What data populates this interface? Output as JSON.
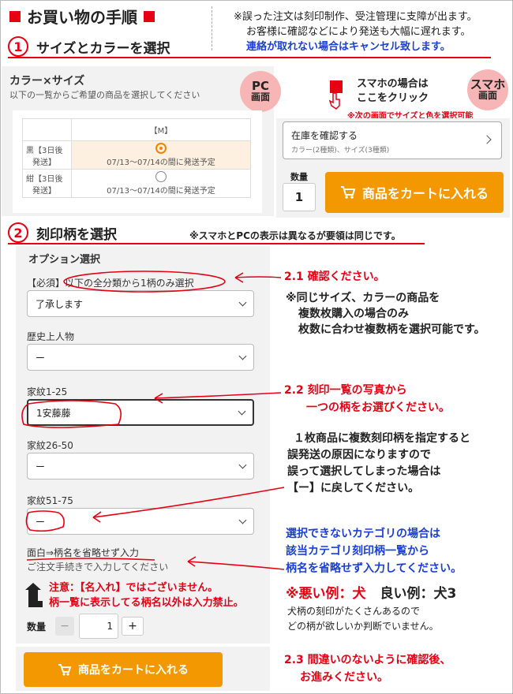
{
  "header": {
    "title": "お買い物の手順",
    "warning_line1": "※誤った注文は刻印制作、受注管理に支障が出ます。",
    "warning_line2": "お客様に確認などにより発送も大幅に遅れます。",
    "warning_line3": "連絡が取れない場合はキャンセル致します。"
  },
  "step1": {
    "number": "1",
    "label": "サイズとカラーを選択"
  },
  "pc_panel": {
    "heading": "カラー×サイズ",
    "sub": "以下の一覧からご希望の商品を選択してください",
    "bubble_top": "PC",
    "bubble_bottom": "画面",
    "table": {
      "col_header": "【M】",
      "rows": [
        {
          "label_line1": "黒【3日後",
          "label_line2": "発送】",
          "note": "07/13〜07/14の間に発送予定",
          "selected": true
        },
        {
          "label_line1": "紺【3日後",
          "label_line2": "発送】",
          "note": "07/13〜07/14の間に発送予定",
          "selected": false
        }
      ]
    }
  },
  "sp_panel": {
    "hint_line1": "スマホの場合は",
    "hint_line2": "ここをクリック",
    "bubble_top": "スマホ",
    "bubble_bottom": "画面",
    "note": "※次の画面でサイズと色を選択可能",
    "stock_title": "在庫を確認する",
    "stock_sub": "カラー(2種類)、サイズ(3種類)",
    "qty_label": "数量",
    "qty_value": "1",
    "cart_label": "商品をカートに入れる"
  },
  "step2": {
    "number": "2",
    "label": "刻印柄を選択",
    "note": "※スマホとPCの表示は異なるが要領は同じです。"
  },
  "options": {
    "heading": "オプション選択",
    "required_label_prefix": "【必須】",
    "required_label": "以下の全分類から1柄のみ選択",
    "required_value": "了承します",
    "history_label": "歴史上人物",
    "history_value": "ー",
    "kamon1_label": "家紋1-25",
    "kamon1_value": "1安藤藤",
    "kamon2_label": "家紋26-50",
    "kamon2_value": "ー",
    "kamon3_label": "家紋51-75",
    "kamon3_value": "ー",
    "free_label": "面白⇒柄名を省略せず入力",
    "free_placeholder": "ご注文手続きで入力してください",
    "caution_line1": "注意：【名入れ】ではございません。",
    "caution_line2": "柄一覧に表示してる柄名以外は入力禁止。",
    "qty_label": "数量",
    "qty_minus": "−",
    "qty_value": "1",
    "qty_plus": "+",
    "cart_label": "商品をカートに入れる"
  },
  "annotations": {
    "a21": "2.1 確認ください。",
    "same_line1": "※同じサイズ、カラーの商品を",
    "same_line2": "複数枚購入の場合のみ",
    "same_line3": "枚数に合わせ複数柄を選択可能です。",
    "a22_line1": "2.2 刻印一覧の写真から",
    "a22_line2": "一つの柄をお選びください。",
    "multi_line1": "１枚商品に複数刻印柄を指定すると",
    "multi_line2": "誤発送の原因になりますので",
    "multi_line3": "誤って選択してしまった場合は",
    "multi_line4": "【ー】に戻してください。",
    "cat_line1": "選択できないカテゴリの場合は",
    "cat_line2": "該当カテゴリ刻印柄一覧から",
    "cat_line3": "柄名を省略せず入力してください。",
    "bad_example": "※悪い例：犬",
    "good_example": "良い例：犬3",
    "dog_line1": "犬柄の刻印がたくさんあるので",
    "dog_line2": "どの柄が欲しいか判断でいません。",
    "a23_line1": "2.3 間違いのないように確認後、",
    "a23_line2": "お進みください。"
  },
  "colors": {
    "accent_red": "#e60012",
    "orange": "#f39800",
    "blue": "#1a3fd6",
    "bubble": "#f8b5b5"
  }
}
